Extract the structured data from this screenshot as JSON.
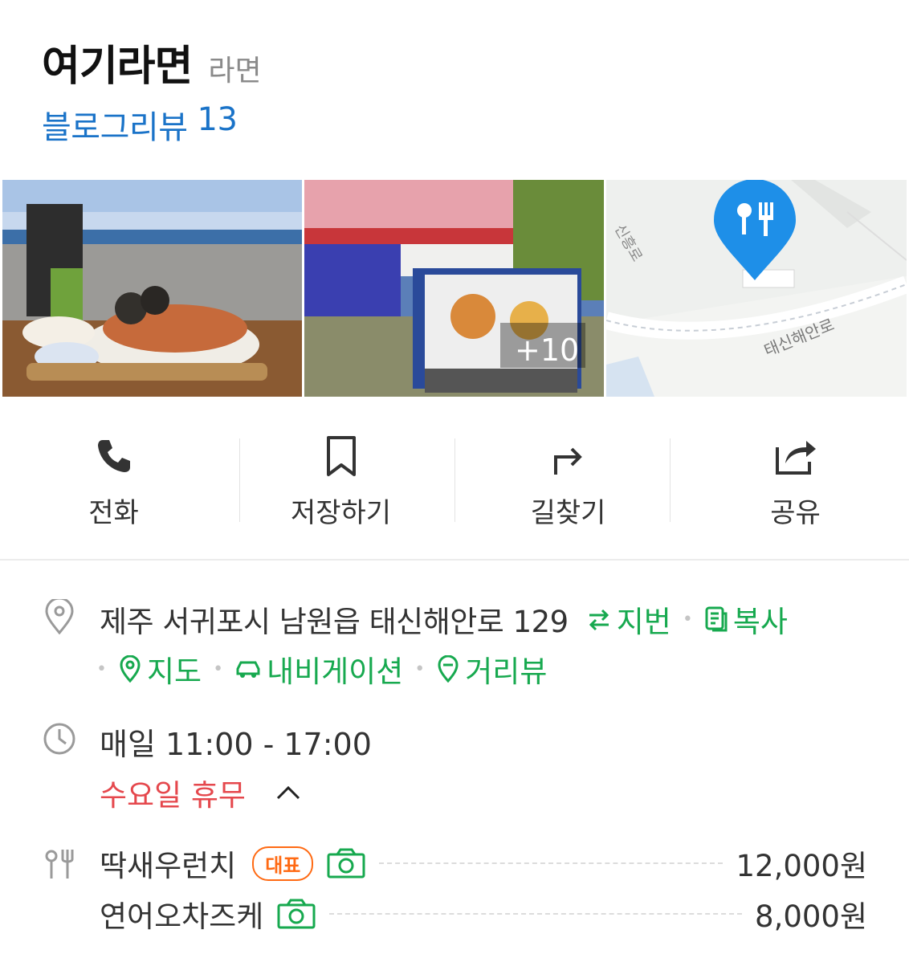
{
  "place": {
    "name": "여기라면",
    "category": "라면",
    "blog_review_label": "블로그리뷰",
    "blog_review_count": "13"
  },
  "photos": {
    "more_label": "+10",
    "map_road_label": "태신해안로",
    "map_road_label2": "신흥로"
  },
  "actions": [
    {
      "label": "전화",
      "icon": "phone-icon"
    },
    {
      "label": "저장하기",
      "icon": "bookmark-icon"
    },
    {
      "label": "길찾기",
      "icon": "directions-icon"
    },
    {
      "label": "공유",
      "icon": "share-icon"
    }
  ],
  "address": {
    "text": "제주 서귀포시 남원읍 태신해안로 129",
    "lot_label": "지번",
    "copy_label": "복사",
    "map_label": "지도",
    "navi_label": "내비게이션",
    "street_label": "거리뷰"
  },
  "hours": {
    "text": "매일 11:00 - 17:00",
    "closed": "수요일 휴무"
  },
  "menu": [
    {
      "name": "딱새우런치",
      "badge": "대표",
      "price": "12,000원"
    },
    {
      "name": "연어오차즈케",
      "price": "8,000원"
    }
  ],
  "colors": {
    "link_blue": "#1a73c8",
    "green": "#17a94f",
    "closed_red": "#e5484d",
    "badge_orange": "#ff6a13",
    "map_pin_blue": "#1e8fe8"
  }
}
